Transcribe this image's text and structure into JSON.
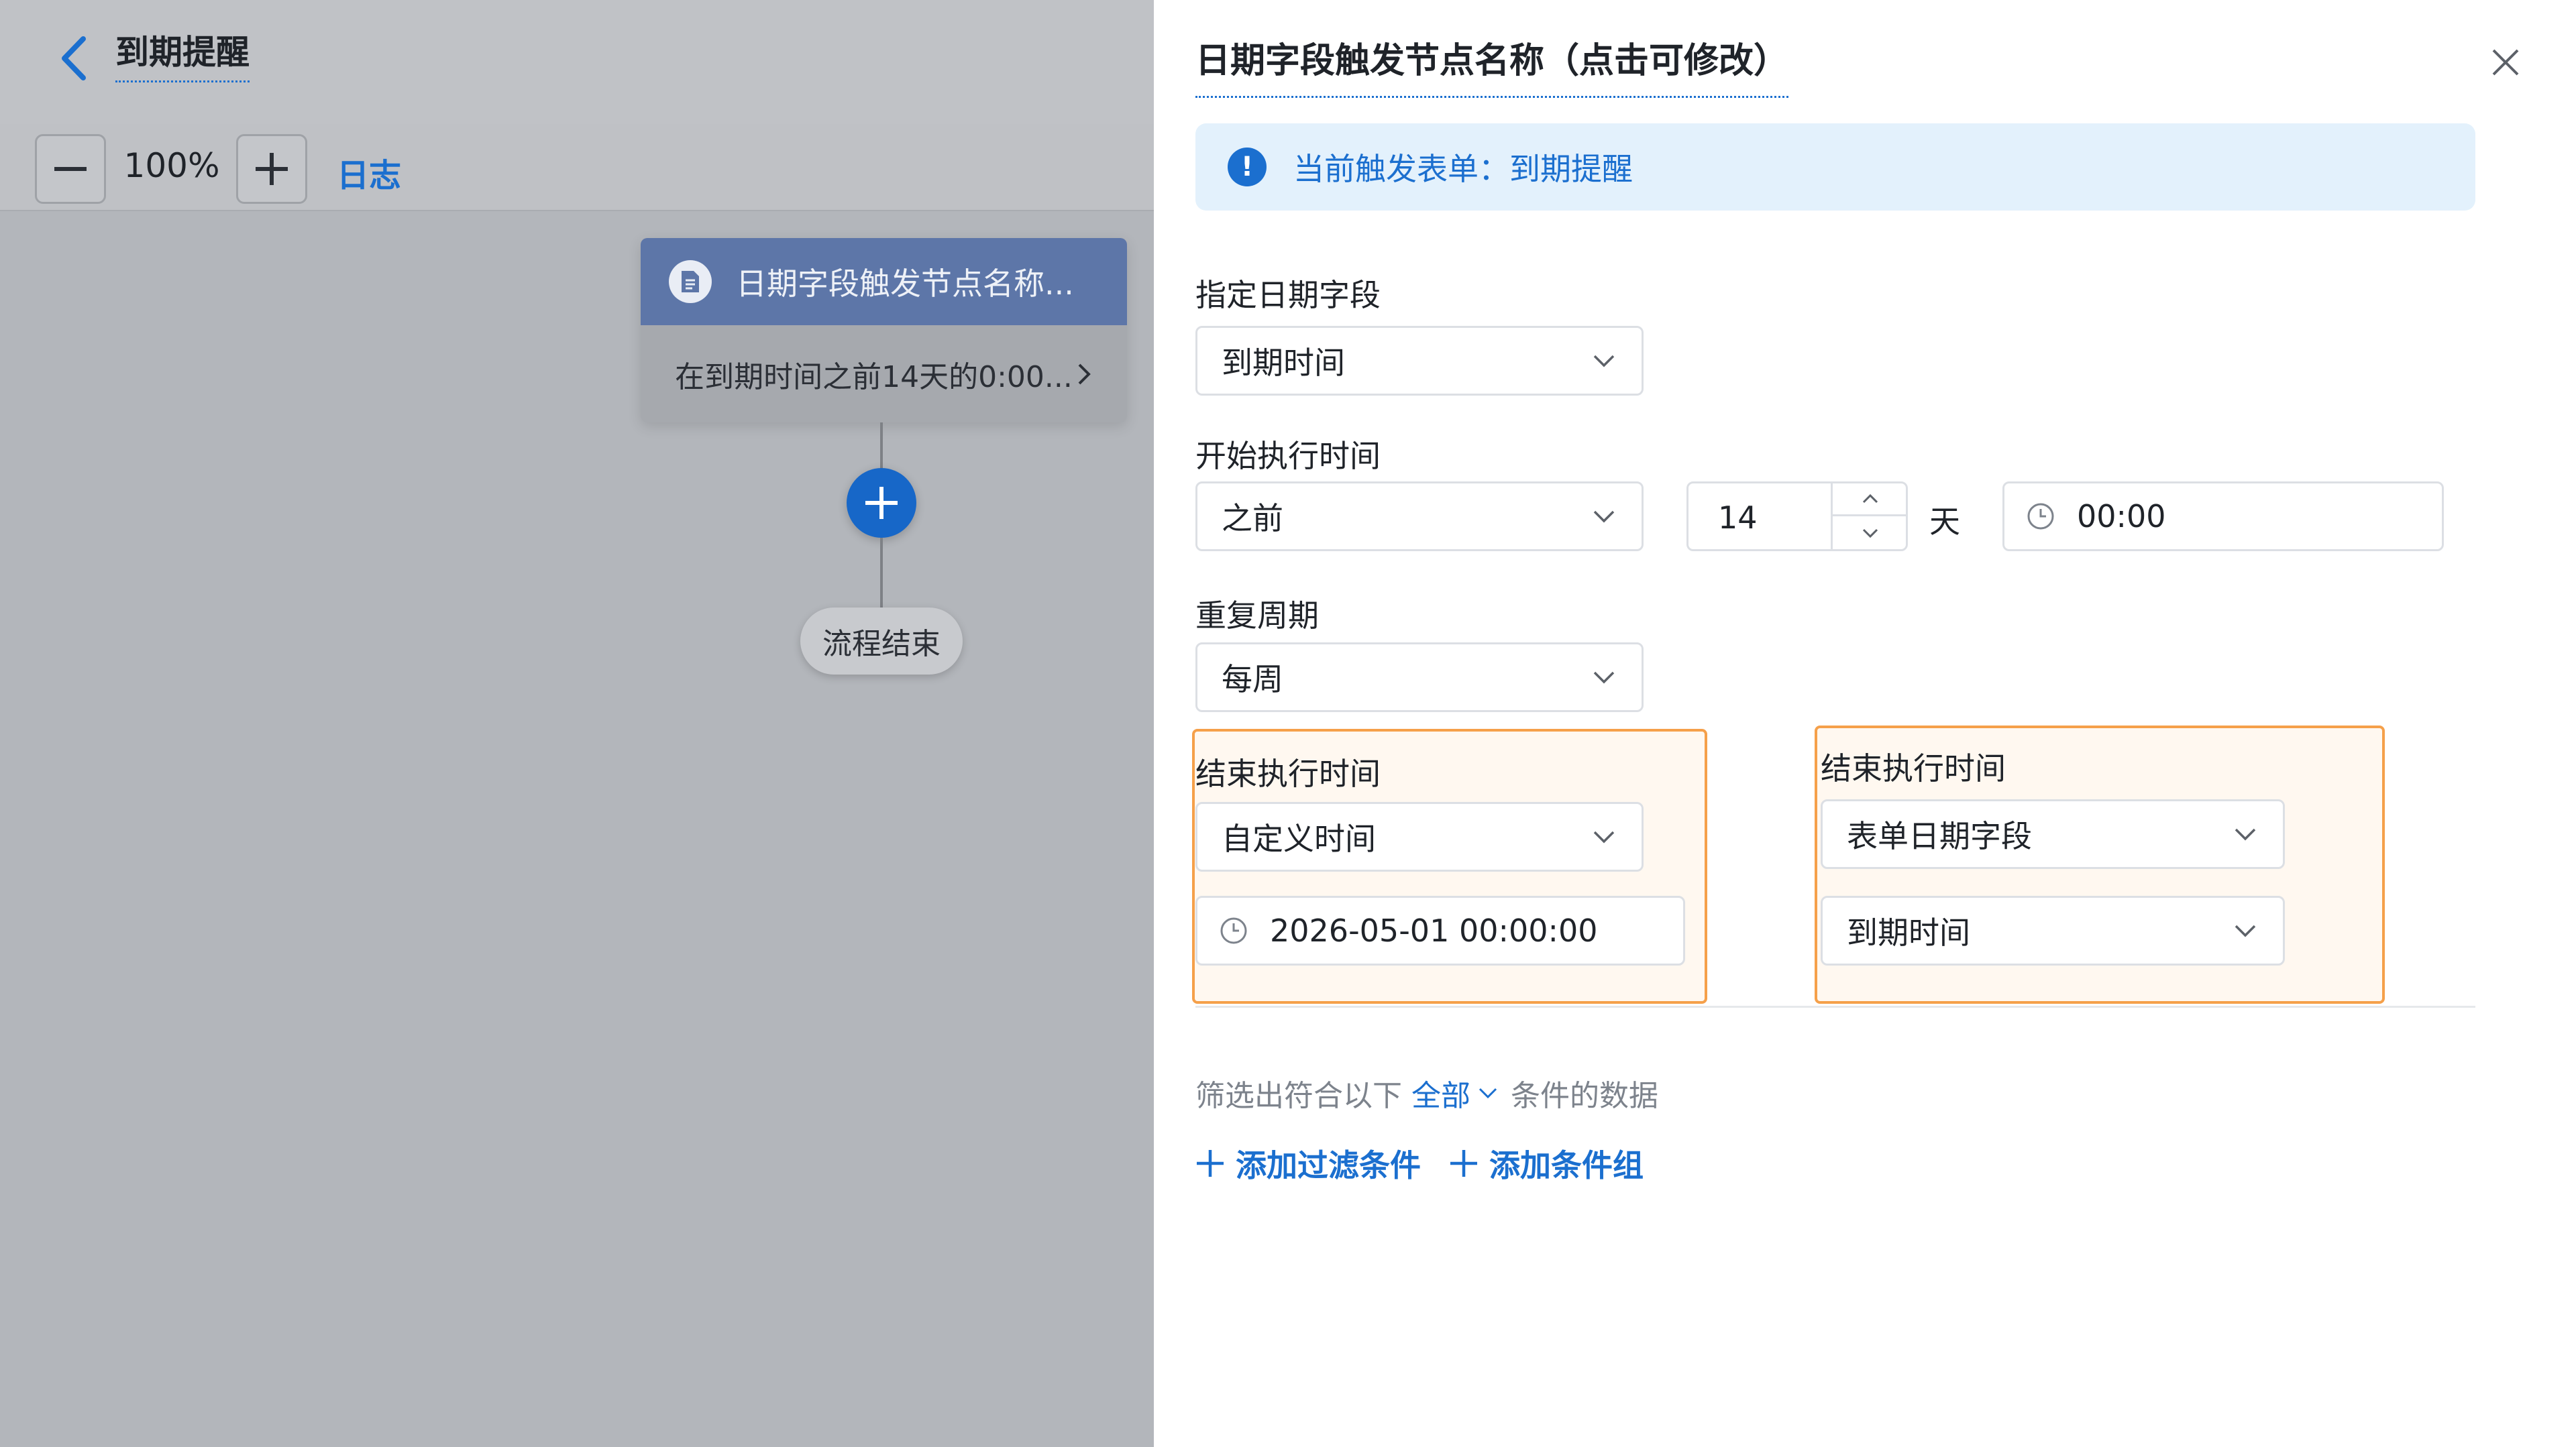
{
  "app": {
    "title": "到期提醒"
  },
  "toolbar": {
    "zoom": "100%",
    "log": "日志"
  },
  "flow": {
    "node_title": "日期字段触发节点名称...",
    "node_summary": "在到期时间之前14天的0:00...",
    "end_label": "流程结束"
  },
  "panel": {
    "title": "日期字段触发节点名称（点击可修改）",
    "info": "当前触发表单：到期提醒",
    "date_field": {
      "label": "指定日期字段",
      "value": "到期时间"
    },
    "start_time": {
      "label": "开始执行时间",
      "relation": "之前",
      "days": "14",
      "unit": "天",
      "time": "00:00"
    },
    "repeat": {
      "label": "重复周期",
      "value": "每周"
    },
    "end_time_a": {
      "label": "结束执行时间",
      "mode": "自定义时间",
      "datetime": "2026-05-01 00:00:00"
    },
    "end_time_b": {
      "label": "结束执行时间",
      "mode": "表单日期字段",
      "field": "到期时间"
    },
    "filter": {
      "prefix": "筛选出符合以下",
      "scope": "全部",
      "suffix": "条件的数据"
    },
    "add_filter": "添加过滤条件",
    "add_group": "添加条件组"
  },
  "colors": {
    "accent": "#1b6fcf",
    "highlight_border": "#f5a04a",
    "node_header": "#5d76a8"
  }
}
